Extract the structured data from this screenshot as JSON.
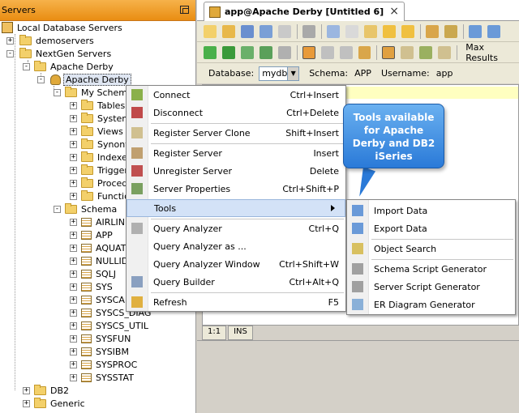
{
  "left_panel": {
    "title": "Servers",
    "tree": {
      "local_servers": "Local Database Servers",
      "demoservers": "demoservers",
      "nextgen_servers": "NextGen Servers",
      "apache_derby_group": "Apache Derby",
      "apache_derby_server": "Apache Derby",
      "my_schema": "My Schema",
      "tables": "Tables",
      "system": "System",
      "views": "Views",
      "synonyms": "Synony",
      "indexes": "Indexe",
      "triggers": "Trigger",
      "procedures": "Proced",
      "functions": "Functio",
      "schema": "Schema",
      "schema_items": [
        "AIRLIN",
        "APP",
        "AQUAT",
        "NULLID",
        "SQLJ",
        "SYS",
        "SYSCA",
        "SYSCS_DIAG",
        "SYSCS_UTIL",
        "SYSFUN",
        "SYSIBM",
        "SYSPROC",
        "SYSSTAT"
      ],
      "db2": "DB2",
      "generic": "Generic"
    }
  },
  "editor": {
    "tab_title": "app@Apache Derby [Untitled 6]",
    "tab_close": "×",
    "max_results_label": "Max Results",
    "database_label": "Database:",
    "database_value": "mydb",
    "schema_label": "Schema:",
    "schema_value": "APP",
    "username_label": "Username:",
    "username_value": "app",
    "cursor_position": "1:1",
    "insert_mode": "INS"
  },
  "context_menu": {
    "items": [
      {
        "label": "Connect",
        "shortcut": "Ctrl+Insert",
        "icon": "connect-icon"
      },
      {
        "label": "Disconnect",
        "shortcut": "Ctrl+Delete",
        "icon": "disconnect-icon"
      },
      {
        "label": "Register Server Clone",
        "shortcut": "Shift+Insert",
        "icon": "clone-icon"
      },
      {
        "label": "Register Server",
        "shortcut": "Insert",
        "icon": "register-icon"
      },
      {
        "label": "Unregister Server",
        "shortcut": "Delete",
        "icon": "unregister-icon"
      },
      {
        "label": "Server Properties",
        "shortcut": "Ctrl+Shift+P",
        "icon": "properties-icon"
      },
      {
        "label": "Tools",
        "shortcut": "",
        "icon": ""
      },
      {
        "label": "Query Analyzer",
        "shortcut": "Ctrl+Q",
        "icon": "query-analyzer-icon"
      },
      {
        "label": "Query Analyzer as ...",
        "shortcut": "",
        "icon": ""
      },
      {
        "label": "Query Analyzer Window",
        "shortcut": "Ctrl+Shift+W",
        "icon": ""
      },
      {
        "label": "Query Builder",
        "shortcut": "Ctrl+Alt+Q",
        "icon": "query-builder-icon"
      },
      {
        "label": "Refresh",
        "shortcut": "F5",
        "icon": "refresh-icon"
      }
    ]
  },
  "tools_submenu": {
    "items": [
      {
        "label": "Import Data",
        "icon": "import-icon"
      },
      {
        "label": "Export Data",
        "icon": "export-icon"
      },
      {
        "label": "Object Search",
        "icon": "search-icon"
      },
      {
        "label": "Schema Script Generator",
        "icon": "schema-script-icon"
      },
      {
        "label": "Server Script Generator",
        "icon": "server-script-icon"
      },
      {
        "label": "ER Diagram Generator",
        "icon": "er-diagram-icon"
      }
    ]
  },
  "callout": {
    "line1": "Tools available",
    "line2": "for Apache",
    "line3": "Derby and DB2",
    "line4": "iSeries"
  },
  "colors": {
    "header_orange": "#e98d12",
    "menu_highlight": "#d3e2f7",
    "callout_blue": "#2a7ad8",
    "editor_highlight": "#ffffc0"
  }
}
